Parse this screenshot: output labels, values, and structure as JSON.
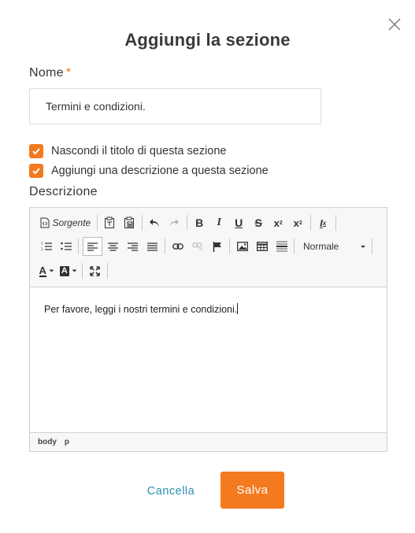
{
  "dialog": {
    "title": "Aggiungi la sezione",
    "name_label": "Nome",
    "required_mark": "*",
    "name_value": "Termini e condizioni.",
    "checkboxes": [
      {
        "label": "Nascondi il titolo di questa sezione",
        "checked": true
      },
      {
        "label": "Aggiungi una descrizione a questa sezione",
        "checked": true
      }
    ],
    "description_label": "Descrizione"
  },
  "editor": {
    "source_label": "Sorgente",
    "format_combo": "Normale",
    "content": "Per favore, leggi i nostri termini e condizioni.",
    "path": [
      "body",
      "p"
    ],
    "icons": {
      "bold": "B",
      "italic": "I",
      "underline": "U",
      "strike": "S",
      "subscript": "x",
      "subscript_mark": "2",
      "superscript": "x",
      "superscript_mark": "2",
      "remove_format": "I",
      "remove_format_mark": "x",
      "text_color": "A",
      "bg_color": "A"
    }
  },
  "actions": {
    "cancel": "Cancella",
    "save": "Salva"
  },
  "colors": {
    "accent": "#f47a1f",
    "link": "#2e8fb0"
  }
}
